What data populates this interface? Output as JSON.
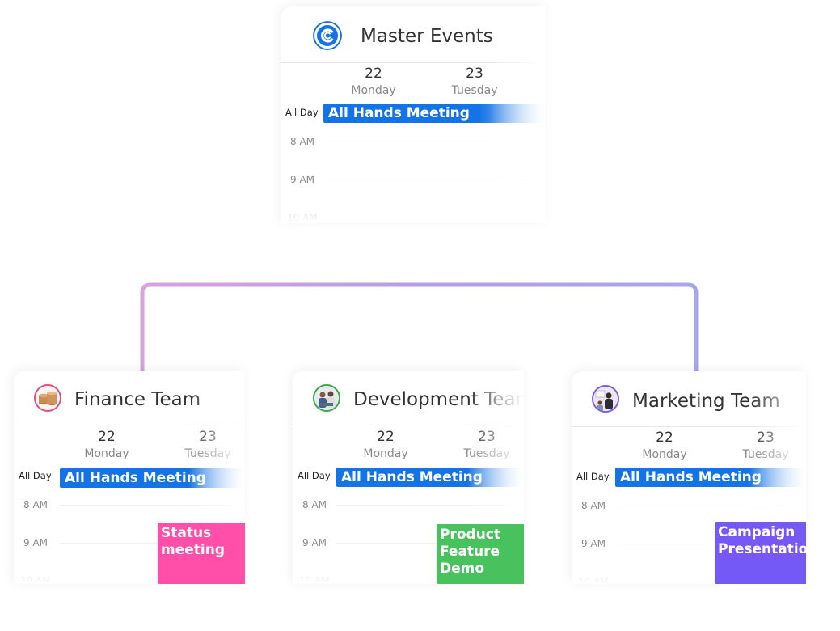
{
  "master": {
    "title": "Master Events",
    "days": [
      {
        "num": "22",
        "name": "Monday"
      },
      {
        "num": "23",
        "name": "Tuesday"
      }
    ],
    "allday_label": "All Day",
    "allday_event": "All Hands Meeting",
    "times": [
      "8 AM",
      "9 AM",
      "10 AM"
    ]
  },
  "teams": [
    {
      "title": "Finance Team",
      "days": [
        {
          "num": "22",
          "name": "Monday"
        },
        {
          "num": "23",
          "name": "Tuesday"
        }
      ],
      "allday_label": "All Day",
      "allday_event": "All Hands Meeting",
      "times": [
        "8 AM",
        "9 AM",
        "10 AM"
      ],
      "event": {
        "label": "Status meeting",
        "color": "#ff4fa8"
      },
      "avatar_ring": "#e44d88"
    },
    {
      "title": "Development Team",
      "days": [
        {
          "num": "22",
          "name": "Monday"
        },
        {
          "num": "23",
          "name": "Tuesday"
        }
      ],
      "allday_label": "All Day",
      "allday_event": "All Hands Meeting",
      "times": [
        "8 AM",
        "9 AM",
        "10 AM"
      ],
      "event": {
        "label": "Product Feature Demo",
        "color": "#47c25c"
      },
      "avatar_ring": "#3fa34d"
    },
    {
      "title": "Marketing Team",
      "days": [
        {
          "num": "22",
          "name": "Monday"
        },
        {
          "num": "23",
          "name": "Tuesday"
        }
      ],
      "allday_label": "All Day",
      "allday_event": "All Hands Meeting",
      "times": [
        "8 AM",
        "9 AM",
        "10 AM"
      ],
      "event": {
        "label": "Campaign Presentation",
        "color": "#7559f7"
      },
      "avatar_ring": "#7a5cf0"
    }
  ],
  "colors": {
    "brand_blue": "#1473e6",
    "connector_blue": "#6fa8f0",
    "connector_purple": "#b79be0",
    "connector_pink": "#f3a9c8"
  },
  "icons": {
    "master_logo": "c-logo-icon",
    "finance_avatar": "coins-avatar-icon",
    "development_avatar": "team-photo-avatar-icon",
    "marketing_avatar": "presenter-avatar-icon"
  }
}
